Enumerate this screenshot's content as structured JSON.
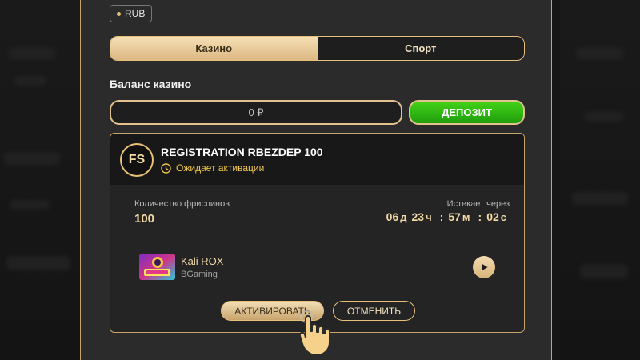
{
  "currency": {
    "label": "RUB"
  },
  "tabs": [
    {
      "label": "Казино",
      "active": true
    },
    {
      "label": "Спорт",
      "active": false
    }
  ],
  "balance": {
    "title": "Баланс казино",
    "value": "0 ₽",
    "deposit_label": "ДЕПОЗИТ"
  },
  "bonus": {
    "badge": "FS",
    "name": "REGISTRATION RBEZDEP 100",
    "status": "Ожидает активации",
    "spins_label": "Количество фриспинов",
    "spins_value": "100",
    "expires_label": "Истекает через",
    "timer": {
      "days": "06",
      "days_unit": "д",
      "hours": "23",
      "hours_unit": "ч",
      "minutes": "57",
      "minutes_unit": "м",
      "seconds": "02",
      "seconds_unit": "с",
      "separator": ":"
    },
    "game": {
      "title": "Kali ROX",
      "provider": "BGaming",
      "icon": "play-icon"
    },
    "activate_label": "АКТИВИРОВАТЬ",
    "cancel_label": "ОТМЕНИТЬ"
  },
  "colors": {
    "gold": "#e8c07a",
    "panel": "#2b2b2b",
    "deposit_green": "#2fb812",
    "status_yellow": "#f2c94c"
  }
}
